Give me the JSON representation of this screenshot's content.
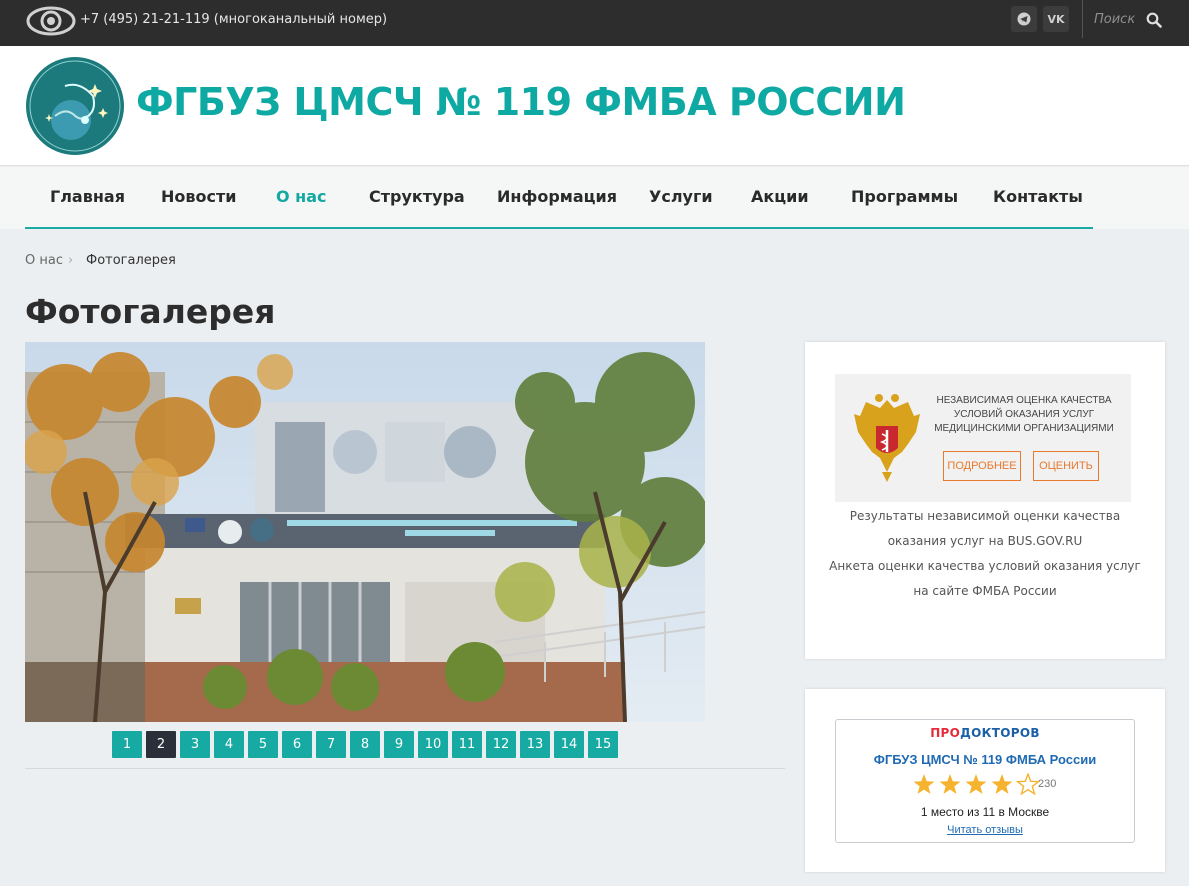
{
  "topbar": {
    "phone": "+7 (495) 21-21-119 (многоканальный номер)",
    "search_placeholder": "Поиск",
    "social": [
      "telegram-icon",
      "vk-icon"
    ],
    "vk_label": "VK"
  },
  "header": {
    "title": "ФГБУЗ ЦМСЧ № 119 ФМБА РОССИИ",
    "brand_color": "#0fa9a4"
  },
  "nav": {
    "items": [
      {
        "label": "Главная"
      },
      {
        "label": "Новости"
      },
      {
        "label": "О нас",
        "active": true
      },
      {
        "label": "Структура"
      },
      {
        "label": "Информация"
      },
      {
        "label": "Услуги"
      },
      {
        "label": "Акции"
      },
      {
        "label": "Программы"
      },
      {
        "label": "Контакты"
      }
    ]
  },
  "breadcrumb": {
    "items": [
      "О нас",
      "Фотогалерея"
    ],
    "separator": "›"
  },
  "page": {
    "title": "Фотогалерея"
  },
  "gallery": {
    "pages": [
      "1",
      "2",
      "3",
      "4",
      "5",
      "6",
      "7",
      "8",
      "9",
      "10",
      "11",
      "12",
      "13",
      "14",
      "15"
    ],
    "current": "2"
  },
  "sidebar": {
    "quality_banner": {
      "text": "Независимая оценка качества условий оказания услуг медицинскими организациями",
      "btn_more": "ПОДРОБНЕЕ",
      "btn_rate": "ОЦЕНИТЬ"
    },
    "link1": "Результаты независимой оценки качества оказания услуг на BUS.GOV.RU",
    "link2": "Анкета оценки качества условий оказания услуг на сайте ФМБА России",
    "prodoctorov": {
      "logo_pro": "ПРО",
      "logo_doc": "ДОКТОРОВ",
      "name": "ФГБУЗ ЦМСЧ № 119 ФМБА России",
      "rating": 4,
      "rating_max": 5,
      "reviews": "230",
      "place": "1 место из 11 в Москве",
      "link": "Читать отзывы"
    }
  }
}
